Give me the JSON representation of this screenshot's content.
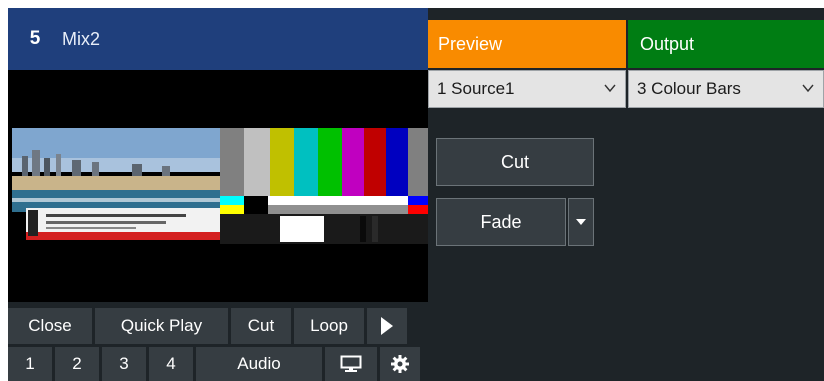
{
  "mix": {
    "number": "5",
    "name": "Mix2"
  },
  "preview": {
    "header": "Preview",
    "selected": "1 Source1"
  },
  "output": {
    "header": "Output",
    "selected": "3 Colour Bars"
  },
  "transitions": {
    "cut_label": "Cut",
    "fade_label": "Fade"
  },
  "actions": {
    "close": "Close",
    "quick_play": "Quick Play",
    "cut": "Cut",
    "loop": "Loop"
  },
  "tabs": {
    "t1": "1",
    "t2": "2",
    "t3": "3",
    "t4": "4",
    "audio": "Audio"
  },
  "icons": {
    "play": "play-icon",
    "monitor": "monitor-icon",
    "settings": "gear-icon",
    "dropdown": "chevron-down-icon",
    "fade_dropdown": "caret-down-icon"
  },
  "colors": {
    "mix_header": "#1f3f7c",
    "preview_header": "#f98b00",
    "output_header": "#007d13",
    "panel_bg": "#1e2428",
    "button_bg": "#363d42"
  }
}
